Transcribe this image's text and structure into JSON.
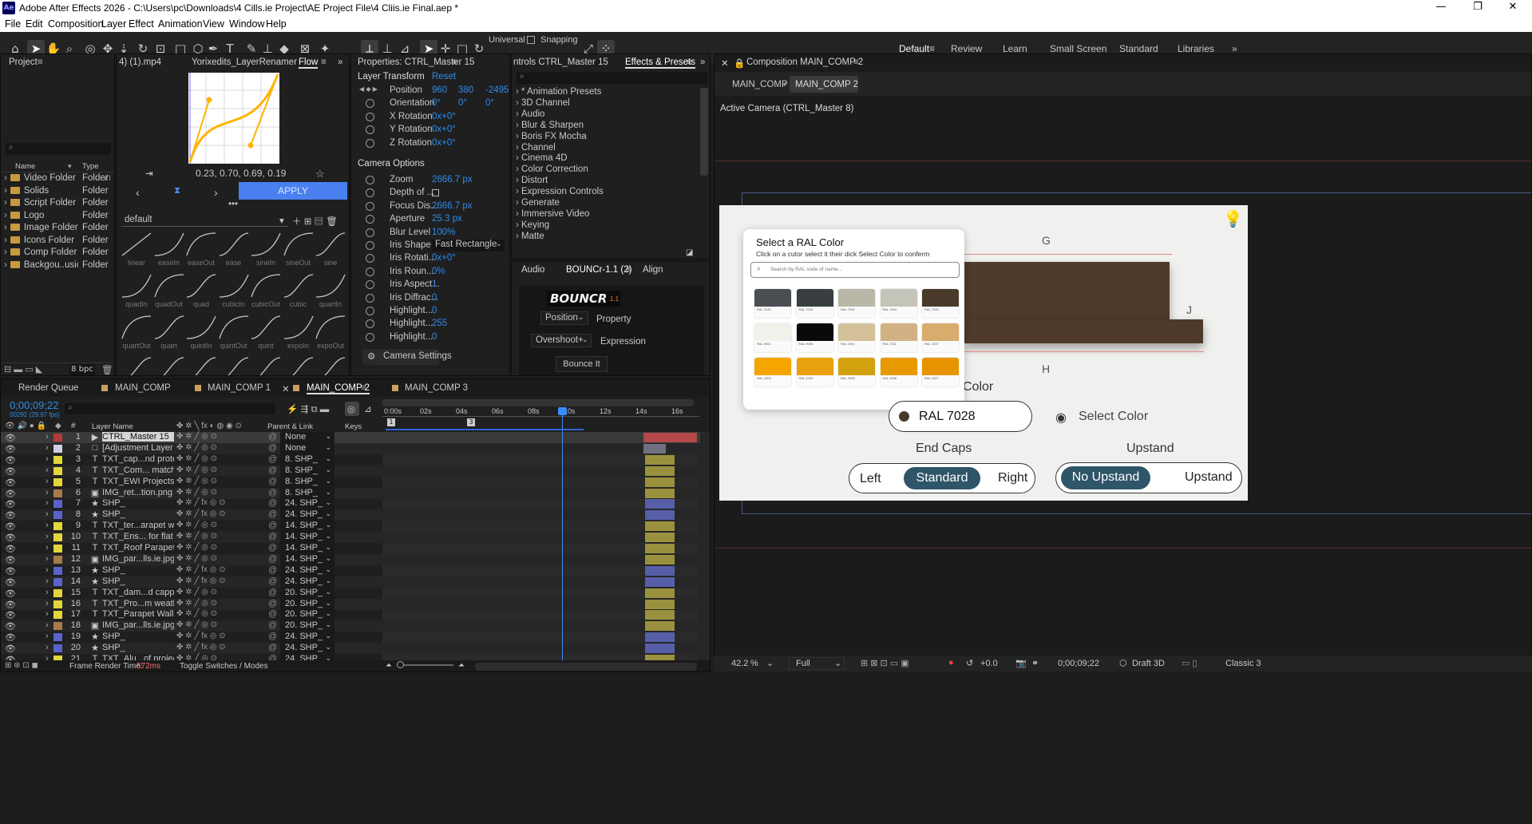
{
  "window": {
    "title": "Adobe After Effects 2026 - C:\\Users\\pc\\Downloads\\4 Cills.ie Project\\AE Project File\\4 Cliis.ie Final.aep *",
    "app_icon": "Ae"
  },
  "menu": [
    "File",
    "Edit",
    "Composition",
    "Layer",
    "Effect",
    "Animation",
    "View",
    "Window",
    "Help"
  ],
  "toolbar": {
    "universal": "Universal",
    "snapping": "Snapping"
  },
  "workspaces": [
    "Default",
    "Review",
    "Learn",
    "Small Screen",
    "Standard",
    "Libraries"
  ],
  "project": {
    "title": "Project",
    "cols": [
      "Name",
      "Type"
    ],
    "bpc": "8 bpc",
    "items": [
      {
        "name": "Video Folder",
        "type": "Folder"
      },
      {
        "name": "Solids",
        "type": "Folder"
      },
      {
        "name": "Script Folder",
        "type": "Folder"
      },
      {
        "name": "Logo",
        "type": "Folder"
      },
      {
        "name": "Image Folder",
        "type": "Folder"
      },
      {
        "name": "Icons Folder",
        "type": "Folder"
      },
      {
        "name": "Comp Folder",
        "type": "Folder"
      },
      {
        "name": "Backgou..usic",
        "type": "Folder"
      }
    ]
  },
  "flow": {
    "tabs": [
      "4) (1).mp4",
      "Yorixedits_LayerRenamer",
      "Flow"
    ],
    "bezier": "0.23, 0.70, 0.69, 0.19",
    "apply": "APPLY",
    "preset": "default",
    "eases": [
      "linear",
      "easeIn",
      "easeOut",
      "ease",
      "sineIn",
      "sineOut",
      "sine",
      "quadIn",
      "quadOut",
      "quad",
      "cubicIn",
      "cubicOut",
      "cubic",
      "quartIn",
      "quartOut",
      "quart",
      "quintIn",
      "quintOut",
      "quint",
      "expoIn",
      "expoOut"
    ]
  },
  "properties": {
    "title": "Properties: CTRL_Master 15",
    "layer_transform": "Layer Transform",
    "reset": "Reset",
    "position": {
      "label": "Position",
      "x": "960",
      "y": "380",
      "z": "-2495"
    },
    "orientation": {
      "label": "Orientation",
      "x": "0°",
      "y": "0°",
      "z": "0°"
    },
    "xrot": {
      "label": "X Rotation",
      "v": "0x+0°"
    },
    "yrot": {
      "label": "Y Rotation",
      "v": "0x+0°"
    },
    "zrot": {
      "label": "Z Rotation",
      "v": "0x+0°"
    },
    "camera_options": "Camera Options",
    "cam": [
      {
        "label": "Zoom",
        "v": "2666.7 px"
      },
      {
        "label": "Depth of ...",
        "v": ""
      },
      {
        "label": "Focus Dis...",
        "v": "2666.7 px"
      },
      {
        "label": "Aperture",
        "v": "25.3 px"
      },
      {
        "label": "Blur Level",
        "v": "100%"
      },
      {
        "label": "Iris Shape",
        "v": "Fast Rectangle"
      },
      {
        "label": "Iris Rotati...",
        "v": "0x+0°"
      },
      {
        "label": "Iris Roun...",
        "v": "0%"
      },
      {
        "label": "Iris Aspect...",
        "v": "1"
      },
      {
        "label": "Iris Diffrac...",
        "v": "0"
      },
      {
        "label": "Highlight...",
        "v": "0"
      },
      {
        "label": "Highlight...",
        "v": "255"
      },
      {
        "label": "Highlight...",
        "v": "0"
      }
    ],
    "camera_settings": "Camera Settings"
  },
  "effects": {
    "tabs": [
      "ntrols CTRL_Master 15",
      "Effects & Presets"
    ],
    "items": [
      "* Animation Presets",
      "3D Channel",
      "Audio",
      "Blur & Sharpen",
      "Boris FX Mocha",
      "Channel",
      "Cinema 4D",
      "Color Correction",
      "Distort",
      "Expression Controls",
      "Generate",
      "Immersive Video",
      "Keying",
      "Matte"
    ]
  },
  "bouncr": {
    "tabs": [
      "Audio",
      "BOUNCr-1.1 (2)",
      "Align"
    ],
    "logo": "BOUNCR",
    "version": "1.1",
    "prop_sel": "Position",
    "prop_lbl": "Property",
    "expr_sel": "Overshoot+",
    "expr_lbl": "Expression",
    "btn": "Bounce It"
  },
  "composition": {
    "title": "Composition MAIN_COMP 2",
    "crumbs": [
      "MAIN_COMP",
      "MAIN_COMP 2"
    ],
    "camera": "Active Camera (CTRL_Master 8)",
    "zoom": "42.2",
    "zoom_unit": "%",
    "res": "Full",
    "exposure": "+0.0",
    "timecode": "0;00;09;22",
    "renderer": "Draft 3D",
    "view": "Classic 3"
  },
  "scene": {
    "modal_title": "Select a RAL Color",
    "modal_sub": "Click on a cutor select it their dick Select Color to conferm",
    "search_ph": "Search by RAL sode of name...",
    "swatches": [
      {
        "c": "#4b4f54",
        "t": "RAL 7015"
      },
      {
        "c": "#383e42",
        "t": "RAL 7016"
      },
      {
        "c": "#b9b8a8",
        "t": "RAL 7032"
      },
      {
        "c": "#c5c4b8",
        "t": "RAL 7044"
      },
      {
        "c": "#4a3a2c",
        "t": "RAL 7028"
      },
      {
        "c": "#f0f1ea",
        "t": "RAL 9001"
      },
      {
        "c": "#0a0a0a",
        "t": "RAL 9005"
      },
      {
        "c": "#d4c19a",
        "t": "RAL 1001"
      },
      {
        "c": "#d2b285",
        "t": "RAL 1011"
      },
      {
        "c": "#d7ac6c",
        "t": "RAL 1037"
      },
      {
        "c": "#f5a500",
        "t": "RAL 1003"
      },
      {
        "c": "#e9a10e",
        "t": "RAL 1004"
      },
      {
        "c": "#d3a10d",
        "t": "RAL 1005"
      },
      {
        "c": "#e69a00",
        "t": "RAL 1006"
      },
      {
        "c": "#e89300",
        "t": "RAL 1007"
      }
    ],
    "label_g": "G",
    "label_j": "J",
    "label_h": "H",
    "color_label": "Color",
    "ral_value": "RAL 7028",
    "ral_dot": "#4a3a2c",
    "select_color": "Select Color",
    "end_caps": "End Caps",
    "upstand": "Upstand",
    "caps": {
      "left": "Left",
      "mid": "Standard",
      "right": "Right"
    },
    "up": {
      "a": "No Upstand",
      "b": "Upstand"
    }
  },
  "timeline": {
    "tabs": [
      "Render Queue",
      "MAIN_COMP",
      "MAIN_COMP 1",
      "MAIN_COMP 2",
      "MAIN_COMP 3"
    ],
    "timecode": "0;00;09;22",
    "frames": "00292 (29.97 fps)",
    "col_layer": "Layer Name",
    "col_parent": "Parent & Link",
    "col_keys": "Keys",
    "ruler": [
      "0:00s",
      "02s",
      "04s",
      "06s",
      "08s",
      "10s",
      "12s",
      "14s",
      "16s"
    ],
    "markers": [
      "1",
      "3"
    ],
    "layers": [
      {
        "n": "1",
        "name": "CTRL_Master 15",
        "color": "#b33a3a",
        "ic": "cam",
        "parent": "None",
        "bar": "#b54848"
      },
      {
        "n": "2",
        "name": "[Adjustment Layer 6]",
        "color": "#d0cfe6",
        "ic": "adj",
        "parent": "None",
        "bar": "#707080"
      },
      {
        "n": "3",
        "name": "TXT_cap...nd protects.",
        "color": "#e3d63c",
        "ic": "T",
        "parent": "8. SHP_",
        "bar": "#9a913f"
      },
      {
        "n": "4",
        "name": "TXT_Com... matching",
        "color": "#e3d63c",
        "ic": "T",
        "parent": "8. SHP_",
        "bar": "#9a913f"
      },
      {
        "n": "5",
        "name": "TXT_EWI Projects",
        "color": "#e3d63c",
        "ic": "T",
        "parent": "8. SHP_",
        "bar": "#9a913f"
      },
      {
        "n": "6",
        "name": "IMG_ret...tion.png",
        "color": "#a67a4a",
        "ic": "img",
        "parent": "8. SHP_",
        "bar": "#9a913f"
      },
      {
        "n": "7",
        "name": "SHP_",
        "color": "#5a63c9",
        "ic": "star",
        "parent": "24. SHP_",
        "bar": "#565fa8"
      },
      {
        "n": "8",
        "name": "SHP_",
        "color": "#5a63c9",
        "ic": "star",
        "parent": "24. SHP_",
        "bar": "#565fa8"
      },
      {
        "n": "9",
        "name": "TXT_ter...arapet walls",
        "color": "#e3d63c",
        "ic": "T",
        "parent": "14. SHP_",
        "bar": "#9a913f"
      },
      {
        "n": "10",
        "name": "TXT_Ens... for flat roof",
        "color": "#e3d63c",
        "ic": "T",
        "parent": "14. SHP_",
        "bar": "#9a913f"
      },
      {
        "n": "11",
        "name": "TXT_Roof Parapets",
        "color": "#e3d63c",
        "ic": "T",
        "parent": "14. SHP_",
        "bar": "#9a913f"
      },
      {
        "n": "12",
        "name": "IMG_par...lls.ie.jpg",
        "color": "#a67a4a",
        "ic": "img",
        "parent": "14. SHP_",
        "bar": "#9a913f"
      },
      {
        "n": "13",
        "name": "SHP_",
        "color": "#5a63c9",
        "ic": "star",
        "parent": "24. SHP_",
        "bar": "#565fa8"
      },
      {
        "n": "14",
        "name": "SHP_",
        "color": "#5a63c9",
        "ic": "star",
        "parent": "24. SHP_",
        "bar": "#565fa8"
      },
      {
        "n": "15",
        "name": "TXT_dam...d capping.",
        "color": "#e3d63c",
        "ic": "T",
        "parent": "20. SHP_",
        "bar": "#9a913f"
      },
      {
        "n": "16",
        "name": "TXT_Pro...m weather",
        "color": "#e3d63c",
        "ic": "T",
        "parent": "20. SHP_",
        "bar": "#9a913f"
      },
      {
        "n": "17",
        "name": "TXT_Parapet Walls",
        "color": "#e3d63c",
        "ic": "T",
        "parent": "20. SHP_",
        "bar": "#9a913f"
      },
      {
        "n": "18",
        "name": "IMG_par...lls.ie.jpg",
        "color": "#a67a4a",
        "ic": "img",
        "parent": "20. SHP_",
        "bar": "#9a913f"
      },
      {
        "n": "19",
        "name": "SHP_",
        "color": "#5a63c9",
        "ic": "star",
        "parent": "24. SHP_",
        "bar": "#565fa8"
      },
      {
        "n": "20",
        "name": "SHP_",
        "color": "#5a63c9",
        "ic": "star",
        "parent": "24. SHP_",
        "bar": "#565fa8"
      },
      {
        "n": "21",
        "name": "TXT_Alu...of projects",
        "color": "#e3d63c",
        "ic": "T",
        "parent": "24. SHP_",
        "bar": "#9a913f"
      }
    ],
    "frame_render_label": "Frame Render Time:",
    "frame_render_value": "572ms",
    "toggle": "Toggle Switches / Modes"
  }
}
